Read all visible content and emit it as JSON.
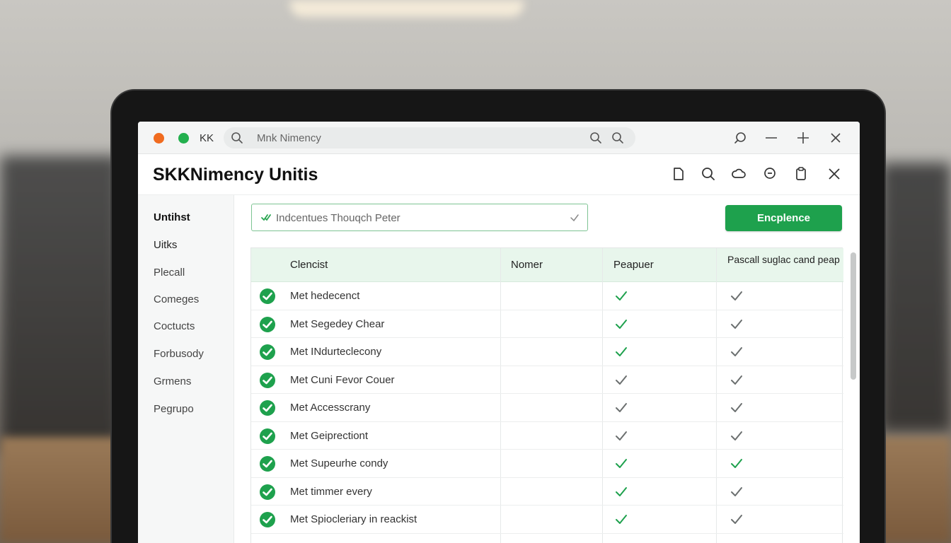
{
  "titlebar": {
    "label": "KK",
    "search_text": "Mnk Nimency"
  },
  "header": {
    "title": "SKKNimency Unitis"
  },
  "sidebar": {
    "items": [
      {
        "label": "Untihst"
      },
      {
        "label": "Uitks"
      },
      {
        "label": "Plecall"
      },
      {
        "label": "Comeges"
      },
      {
        "label": "Coctucts"
      },
      {
        "label": "Forbusody"
      },
      {
        "label": "Grmens"
      },
      {
        "label": "Pegrupo"
      }
    ]
  },
  "filter": {
    "value": "Indcentues Thouqch Peter"
  },
  "primary_button": {
    "label": "Encplence"
  },
  "table": {
    "headers": [
      "Clencist",
      "Nomer",
      "Peapuer",
      "Pascall suglac cand peap"
    ],
    "rows": [
      {
        "name": "Met hedecenct",
        "col3": "green",
        "col4": "gray"
      },
      {
        "name": "Met Segedey Chear",
        "col3": "green",
        "col4": "gray"
      },
      {
        "name": "Met INdurteclecony",
        "col3": "green",
        "col4": "gray"
      },
      {
        "name": "Met Cuni Fevor Couer",
        "col3": "gray",
        "col4": "gray"
      },
      {
        "name": "Met Accesscrany",
        "col3": "gray",
        "col4": "gray"
      },
      {
        "name": "Met Geiprectiont",
        "col3": "gray",
        "col4": "gray"
      },
      {
        "name": "Met Supeurhe condy",
        "col3": "green",
        "col4": "green"
      },
      {
        "name": "Met timmer every",
        "col3": "green",
        "col4": "gray"
      },
      {
        "name": "Met Spiocleriary in reackist",
        "col3": "green",
        "col4": "gray"
      }
    ]
  },
  "colors": {
    "accent_green": "#1ea14d",
    "check_gray": "#6b6f6f",
    "header_tint": "#e8f6ec"
  }
}
